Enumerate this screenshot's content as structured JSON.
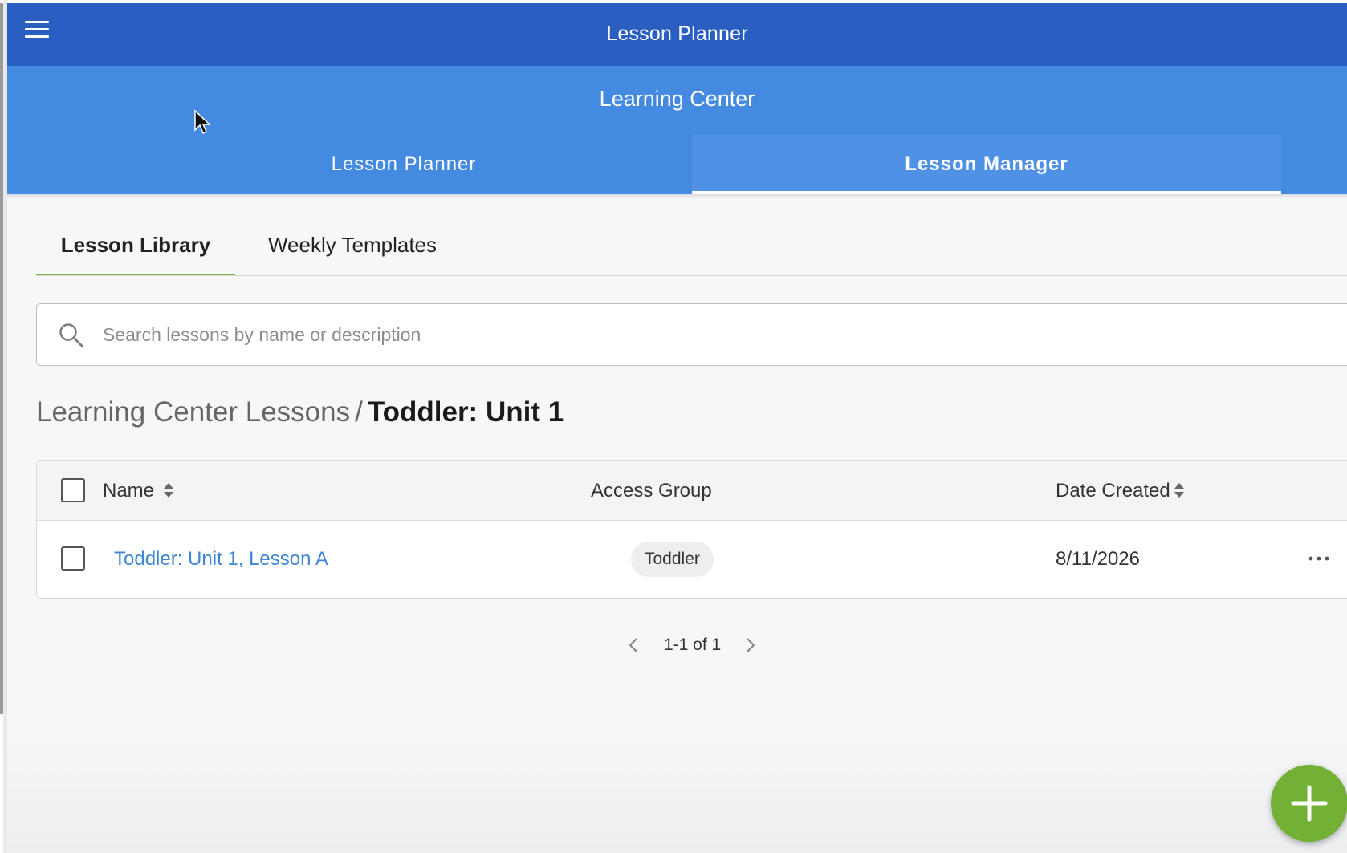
{
  "header": {
    "title": "Lesson Planner",
    "menu_icon": "hamburger-menu-icon",
    "color": "#2a5fc1"
  },
  "subheader": {
    "title": "Learning Center",
    "color": "#448ae1",
    "tabs": [
      {
        "label": "Lesson Planner",
        "active": false
      },
      {
        "label": "Lesson Manager",
        "active": true
      }
    ]
  },
  "library_tabs": {
    "items": [
      {
        "label": "Lesson Library",
        "active": true
      },
      {
        "label": "Weekly Templates",
        "active": false
      }
    ],
    "active_indicator_color": "#7cb342"
  },
  "search": {
    "placeholder": "Search lessons by name or description",
    "value": "",
    "icon": "search-icon"
  },
  "breadcrumb": {
    "parent": "Learning Center Lessons",
    "separator": "/",
    "current": "Toddler: Unit 1"
  },
  "table": {
    "columns": [
      {
        "label": "Name",
        "sortable": true
      },
      {
        "label": "Access Group",
        "sortable": false
      },
      {
        "label": "Date Created",
        "sortable": true
      }
    ],
    "rows": [
      {
        "name": "Toddler: Unit 1, Lesson A",
        "access_group": "Toddler",
        "date_created": "8/11/2026",
        "checked": false
      }
    ]
  },
  "pagination": {
    "label": "1-1 of 1"
  },
  "fab": {
    "icon": "plus-icon",
    "color": "#72b136"
  }
}
